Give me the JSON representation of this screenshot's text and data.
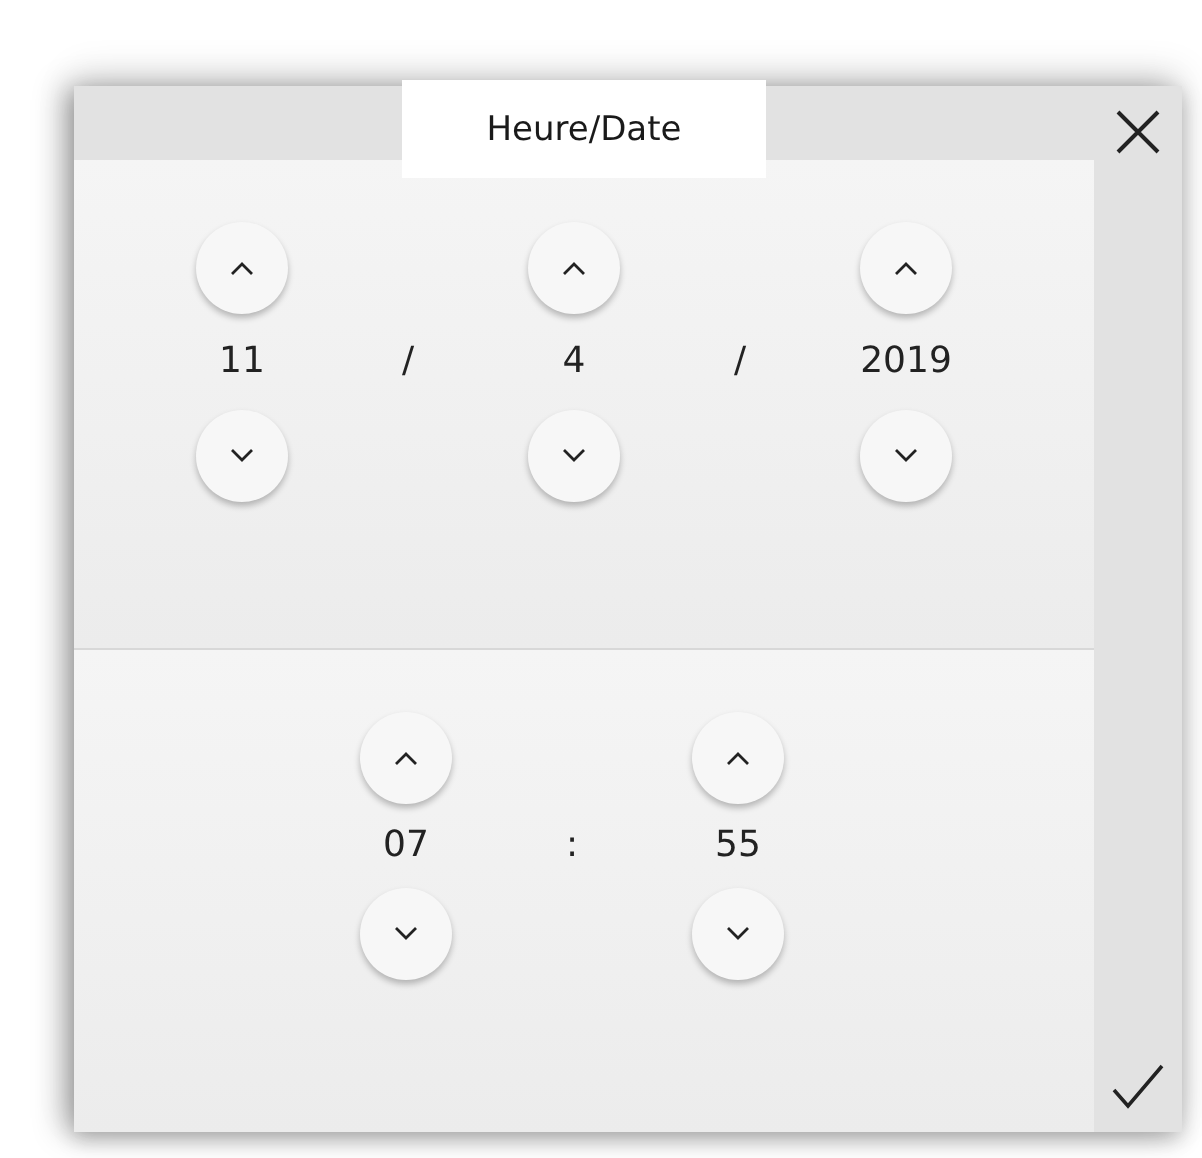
{
  "dialog": {
    "title": "Heure/Date"
  },
  "date": [
    {
      "kind": "field",
      "value": "11"
    },
    {
      "kind": "separator",
      "text": "/"
    },
    {
      "kind": "field",
      "value": "4"
    },
    {
      "kind": "separator",
      "text": "/"
    },
    {
      "kind": "field",
      "value": "2019"
    }
  ],
  "time": [
    {
      "kind": "field",
      "value": "07"
    },
    {
      "kind": "separator",
      "text": ":"
    },
    {
      "kind": "field",
      "value": "55"
    }
  ]
}
